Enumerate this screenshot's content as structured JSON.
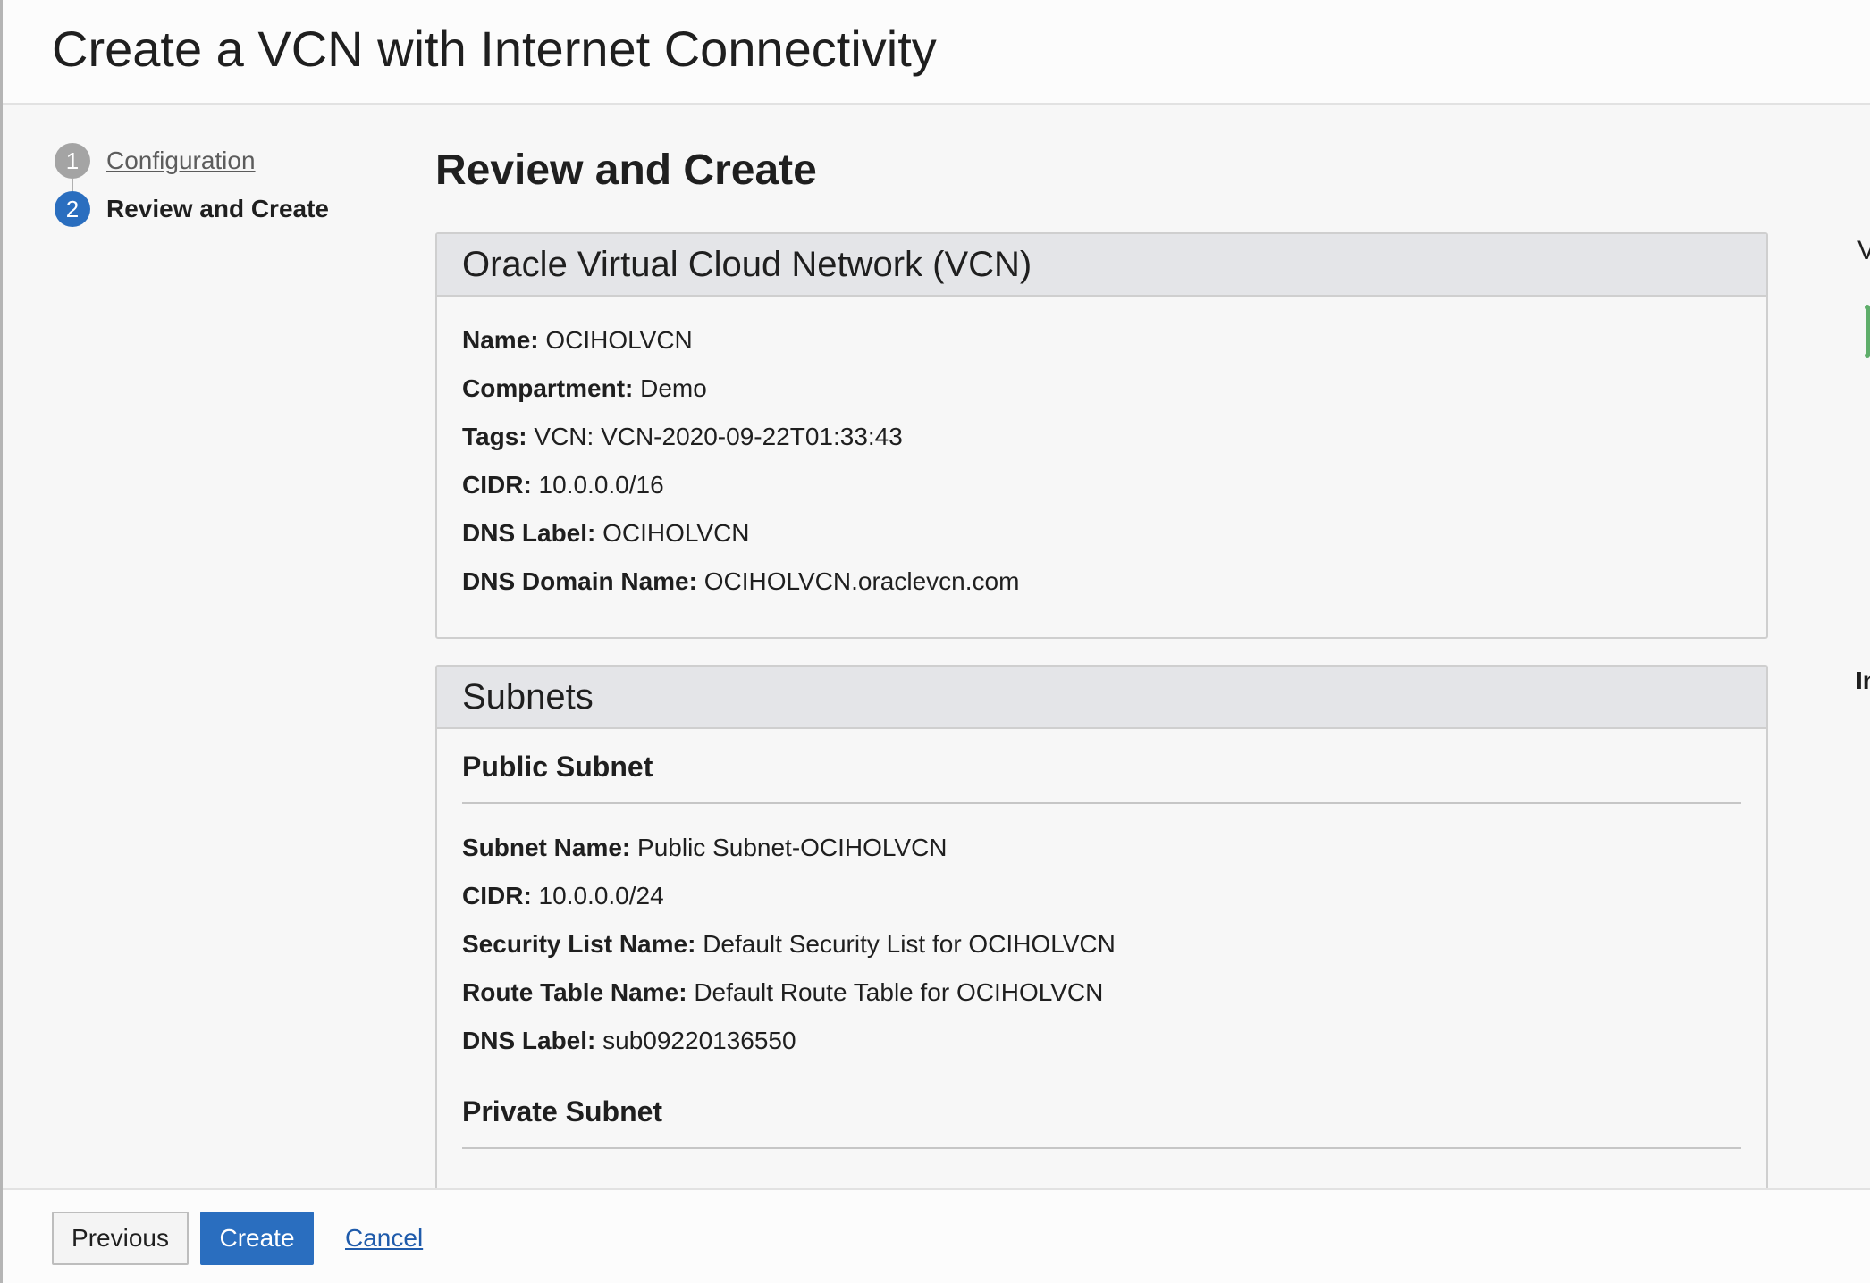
{
  "header": {
    "title": "Create a VCN with Internet Connectivity"
  },
  "steps": [
    {
      "number": "1",
      "label": "Configuration",
      "state": "completed"
    },
    {
      "number": "2",
      "label": "Review and Create",
      "state": "current"
    }
  ],
  "main": {
    "title": "Review and Create"
  },
  "vcn_section": {
    "title": "Oracle Virtual Cloud Network (VCN)",
    "fields": [
      {
        "label": "Name:",
        "value": "OCIHOLVCN"
      },
      {
        "label": "Compartment:",
        "value": "Demo"
      },
      {
        "label": "Tags:",
        "value": "VCN: VCN-2020-09-22T01:33:43"
      },
      {
        "label": "CIDR:",
        "value": "10.0.0.0/16"
      },
      {
        "label": "DNS Label:",
        "value": "OCIHOLVCN"
      },
      {
        "label": "DNS Domain Name:",
        "value": "OCIHOLVCN.oraclevcn.com"
      }
    ]
  },
  "subnets_section": {
    "title": "Subnets",
    "public": {
      "title": "Public Subnet",
      "fields": [
        {
          "label": "Subnet Name:",
          "value": "Public Subnet-OCIHOLVCN"
        },
        {
          "label": "CIDR:",
          "value": "10.0.0.0/24"
        },
        {
          "label": "Security List Name:",
          "value": "Default Security List for OCIHOLVCN"
        },
        {
          "label": "Route Table Name:",
          "value": "Default Route Table for OCIHOLVCN"
        },
        {
          "label": "DNS Label:",
          "value": "sub09220136550"
        }
      ]
    },
    "private": {
      "title": "Private Subnet"
    }
  },
  "right_panel": {
    "clip_top": "V",
    "clip_bottom": "In"
  },
  "footer": {
    "previous_label": "Previous",
    "create_label": "Create",
    "cancel_label": "Cancel"
  },
  "colors": {
    "primary": "#2a6ebf",
    "link": "#1f5bab",
    "accent_green": "#5fae6b"
  }
}
